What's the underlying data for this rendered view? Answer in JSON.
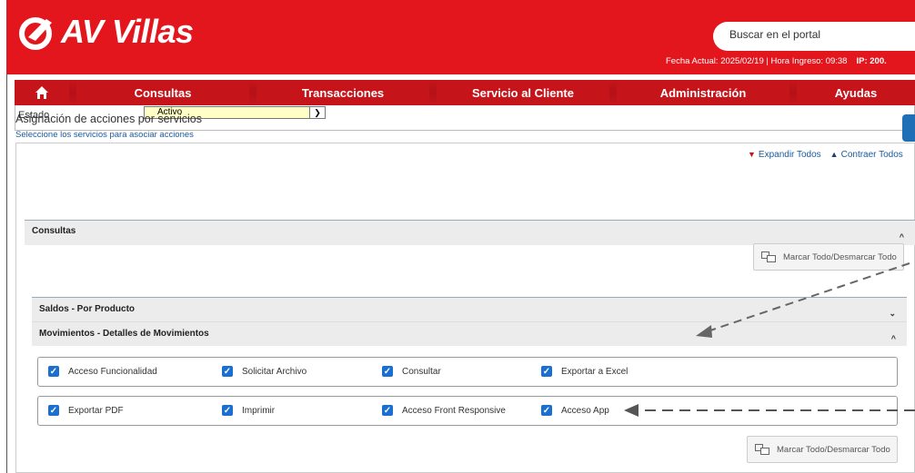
{
  "header": {
    "brand": "AV Villas",
    "search_placeholder": "Buscar en el portal",
    "fecha_text": "Fecha Actual: 2025/02/19 | Hora Ingreso: 09:38",
    "ip_text": "IP: 200."
  },
  "nav": {
    "items": [
      "Consultas",
      "Transacciones",
      "Servicio al Cliente",
      "Administración",
      "Ayudas"
    ]
  },
  "estado": {
    "label": "Estado",
    "value": "Activo"
  },
  "section": {
    "title": "Asignación de acciones por servicios",
    "subtitle": "Seleccione los servicios para asociar acciones",
    "expand_all": "Expandir Todos",
    "collapse_all": "Contraer Todos"
  },
  "consultas": {
    "title": "Consultas",
    "marcar_label": "Marcar Todo/Desmarcar Todo",
    "saldos_title": "Saldos - Por Producto",
    "movimientos_title": "Movimientos - Detalles de Movimientos",
    "group1": [
      "Acceso Funcionalidad",
      "Solicitar Archivo",
      "Consultar",
      "Exportar a Excel"
    ],
    "group2": [
      "Exportar PDF",
      "Imprimir",
      "Acceso Front Responsive",
      "Acceso App"
    ],
    "marcar_label2": "Marcar Todo/Desmarcar Todo"
  },
  "colors": {
    "brand_red": "#e3161d",
    "nav_red": "#c6141b",
    "check_blue": "#1a6fd1"
  }
}
